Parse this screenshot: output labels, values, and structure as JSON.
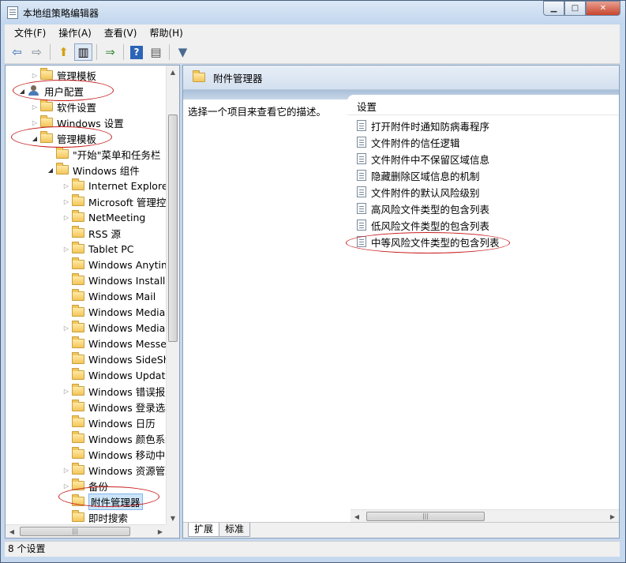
{
  "window": {
    "title": "本地组策略编辑器",
    "minimize_glyph": "▁",
    "maximize_glyph": "□",
    "close_glyph": "✕"
  },
  "menu": [
    "文件(F)",
    "操作(A)",
    "查看(V)",
    "帮助(H)"
  ],
  "toolbar": {
    "back_glyph": "⇦",
    "forward_glyph": "⇨",
    "up_glyph": "⬆",
    "tree_glyph": "▥",
    "export_glyph": "⇒",
    "help_glyph": "?",
    "properties_glyph": "▤",
    "filter_glyph": "▼"
  },
  "tree": {
    "items": [
      {
        "label": "管理模板",
        "arrow": "▷",
        "icon": "folder-icon"
      },
      {
        "label": "用户配置",
        "arrow": "◢",
        "icon": "user-icon"
      },
      {
        "label": "软件设置",
        "arrow": "▷",
        "icon": "folder-icon"
      },
      {
        "label": "Windows 设置",
        "arrow": "▷",
        "icon": "folder-icon"
      },
      {
        "label": "管理模板",
        "arrow": "◢",
        "icon": "folder-icon"
      },
      {
        "label": "\"开始\"菜单和任务栏",
        "arrow": "",
        "icon": "folder-icon"
      },
      {
        "label": "Windows 组件",
        "arrow": "◢",
        "icon": "folder-icon"
      },
      {
        "label": "Internet Explorer",
        "arrow": "▷",
        "icon": "folder-icon"
      },
      {
        "label": "Microsoft 管理控制台",
        "arrow": "▷",
        "icon": "folder-icon"
      },
      {
        "label": "NetMeeting",
        "arrow": "▷",
        "icon": "folder-icon"
      },
      {
        "label": "RSS 源",
        "arrow": "",
        "icon": "folder-icon"
      },
      {
        "label": "Tablet PC",
        "arrow": "▷",
        "icon": "folder-icon"
      },
      {
        "label": "Windows Anytime",
        "arrow": "",
        "icon": "folder-icon"
      },
      {
        "label": "Windows Installer",
        "arrow": "",
        "icon": "folder-icon"
      },
      {
        "label": "Windows Mail",
        "arrow": "",
        "icon": "folder-icon"
      },
      {
        "label": "Windows Media",
        "arrow": "",
        "icon": "folder-icon"
      },
      {
        "label": "Windows Media",
        "arrow": "▷",
        "icon": "folder-icon"
      },
      {
        "label": "Windows Messenger",
        "arrow": "",
        "icon": "folder-icon"
      },
      {
        "label": "Windows SideShow",
        "arrow": "",
        "icon": "folder-icon"
      },
      {
        "label": "Windows Update",
        "arrow": "",
        "icon": "folder-icon"
      },
      {
        "label": "Windows 错误报告",
        "arrow": "▷",
        "icon": "folder-icon"
      },
      {
        "label": "Windows 登录选项",
        "arrow": "",
        "icon": "folder-icon"
      },
      {
        "label": "Windows 日历",
        "arrow": "",
        "icon": "folder-icon"
      },
      {
        "label": "Windows 颜色系统",
        "arrow": "",
        "icon": "folder-icon"
      },
      {
        "label": "Windows 移动中心",
        "arrow": "",
        "icon": "folder-icon"
      },
      {
        "label": "Windows 资源管理器",
        "arrow": "▷",
        "icon": "folder-icon"
      },
      {
        "label": "备份",
        "arrow": "▷",
        "icon": "folder-icon"
      },
      {
        "label": "附件管理器",
        "arrow": "",
        "icon": "folder-icon"
      },
      {
        "label": "即时搜索",
        "arrow": "",
        "icon": "folder-icon"
      }
    ],
    "scroll_up_glyph": "▲",
    "scroll_down_glyph": "▼",
    "scroll_left_glyph": "◀",
    "scroll_right_glyph": "▶",
    "grip_glyph": "≡",
    "hgrip_glyph": "|||"
  },
  "detail": {
    "header_title": "附件管理器",
    "description": "选择一个项目来查看它的描述。",
    "column_header": "设置",
    "settings": [
      "打开附件时通知防病毒程序",
      "文件附件的信任逻辑",
      "文件附件中不保留区域信息",
      "隐藏删除区域信息的机制",
      "文件附件的默认风险级别",
      "高风险文件类型的包含列表",
      "低风险文件类型的包含列表",
      "中等风险文件类型的包含列表"
    ],
    "tabs": [
      "扩展",
      "标准"
    ]
  },
  "status": {
    "text": "8 个设置"
  },
  "colors": {
    "annotation": "#c81e1e",
    "selection": "#cce4f7"
  }
}
